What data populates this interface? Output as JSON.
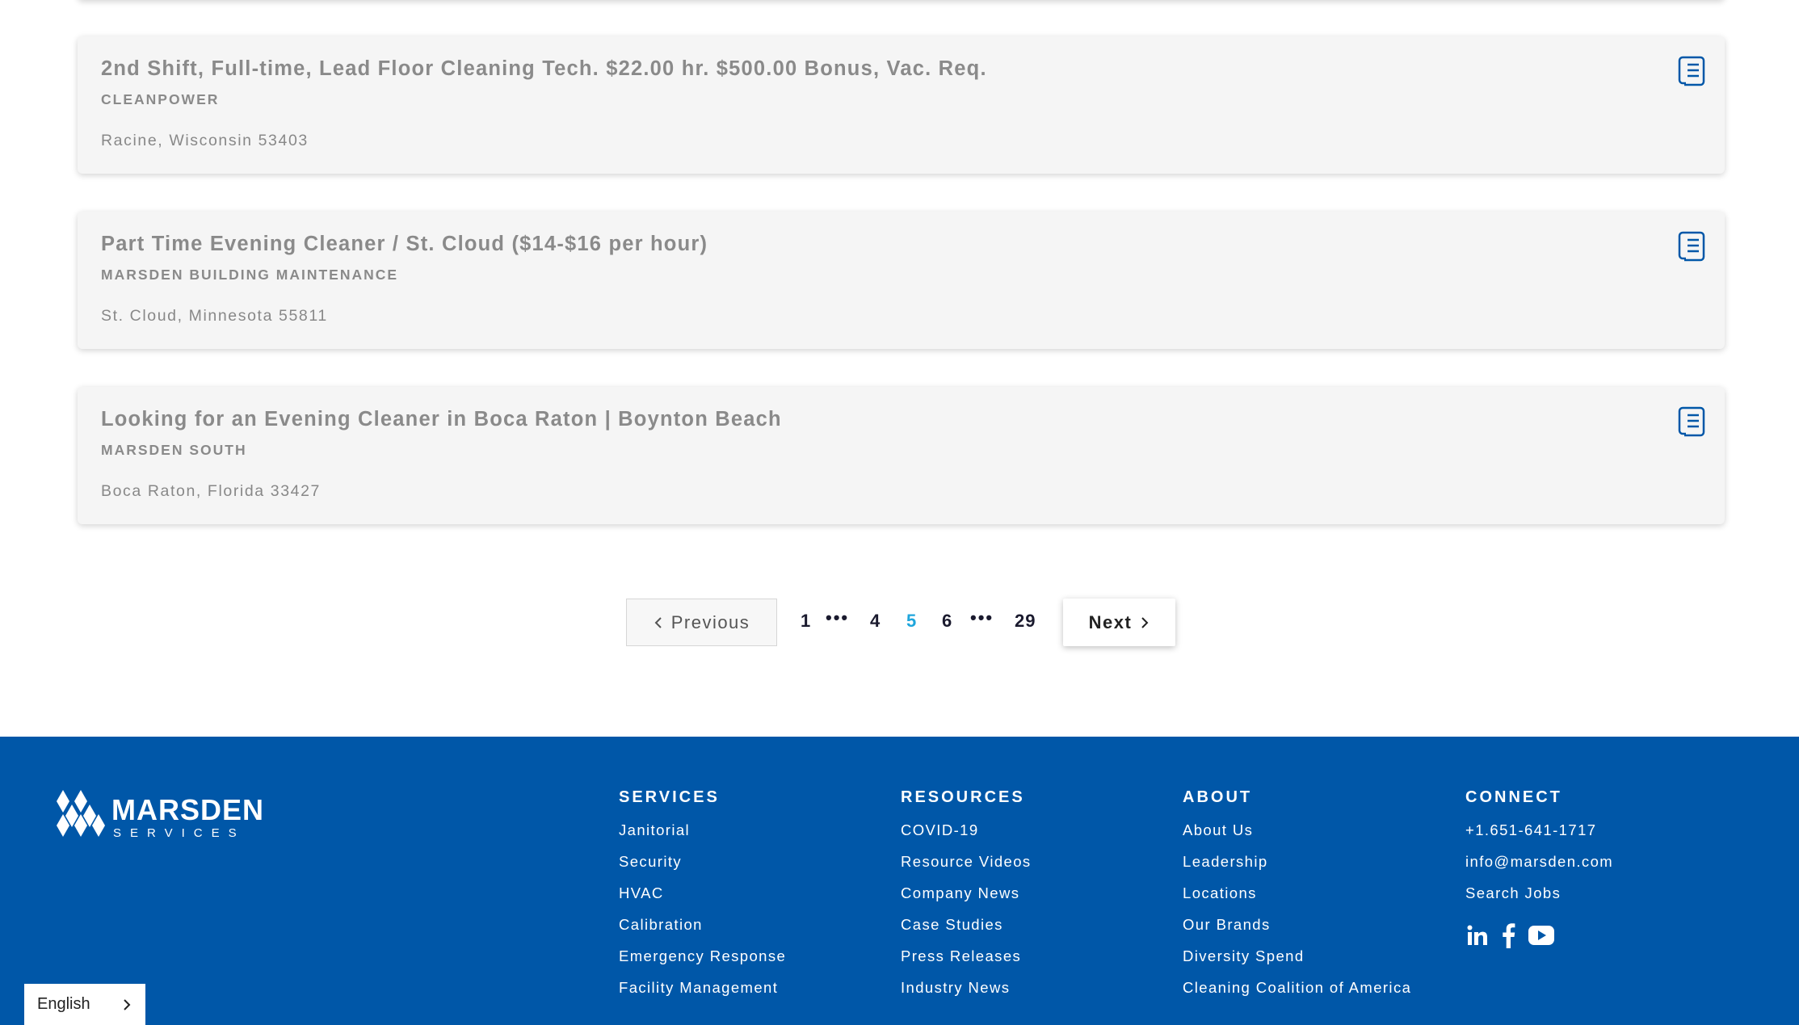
{
  "jobs": [
    {
      "title": "2nd Shift, Full-time, Lead Floor Cleaning Tech. $22.00 hr. $500.00 Bonus, Vac. Req.",
      "company": "CLEANPOWER",
      "location": "Racine, Wisconsin 53403"
    },
    {
      "title": "Part Time Evening Cleaner / St. Cloud ($14-$16 per hour)",
      "company": "MARSDEN BUILDING MAINTENANCE",
      "location": "St. Cloud, Minnesota 55811"
    },
    {
      "title": "Looking for an Evening Cleaner in Boca Raton | Boynton Beach",
      "company": "MARSDEN SOUTH",
      "location": "Boca Raton, Florida 33427"
    }
  ],
  "pagination": {
    "previous_label": "Previous",
    "next_label": "Next",
    "pages": [
      "1",
      "4",
      "5",
      "6",
      "29"
    ],
    "current": "5",
    "ellipsis": "•••"
  },
  "footer": {
    "logo_text": "MARSDEN",
    "logo_sub": "SERVICES",
    "services": {
      "heading": "SERVICES",
      "links": [
        "Janitorial",
        "Security",
        "HVAC",
        "Calibration",
        "Emergency Response",
        "Facility Management"
      ]
    },
    "resources": {
      "heading": "RESOURCES",
      "links": [
        "COVID-19",
        "Resource Videos",
        "Company News",
        "Case Studies",
        "Press Releases",
        "Industry News"
      ]
    },
    "about": {
      "heading": "ABOUT",
      "links": [
        "About Us",
        "Leadership",
        "Locations",
        "Our Brands",
        "Diversity Spend",
        "Cleaning Coalition of America"
      ]
    },
    "connect": {
      "heading": "CONNECT",
      "links": [
        "+1.651-641-1717",
        "info@marsden.com",
        "Search Jobs"
      ]
    },
    "social_icons": [
      "linkedin-icon",
      "facebook-icon",
      "youtube-icon"
    ]
  },
  "language": {
    "selected": "English"
  },
  "colors": {
    "footer_bg": "#0057a8",
    "current_page": "#1fa6dc",
    "doc_icon": "#0057a8"
  }
}
